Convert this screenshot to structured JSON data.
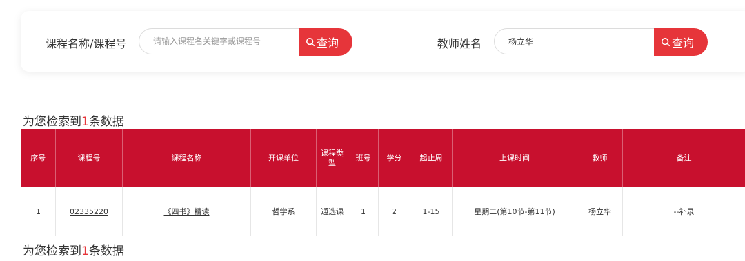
{
  "search": {
    "course_label": "课程名称/课程号",
    "course_placeholder": "请输入课程名关键字或课程号",
    "course_value": "",
    "course_button": "查询",
    "teacher_label": "教师姓名",
    "teacher_value": "杨立华",
    "teacher_button": "查询"
  },
  "summary": {
    "prefix": "为您检索到",
    "count": "1",
    "suffix": "条数据"
  },
  "table": {
    "headers": [
      "序号",
      "课程号",
      "课程名称",
      "开课单位",
      "课程类型",
      "班号",
      "学分",
      "起止周",
      "上课时间",
      "教师",
      "备注"
    ],
    "rows": [
      [
        "1",
        "02335220",
        "《四书》精读",
        "哲学系",
        "通选课",
        "1",
        "2",
        "1-15",
        "星期二(第10节-第11节)",
        "杨立华",
        "--补录"
      ]
    ]
  },
  "colors": {
    "accent": "#e6353a",
    "header_bg": "#c8102e"
  }
}
